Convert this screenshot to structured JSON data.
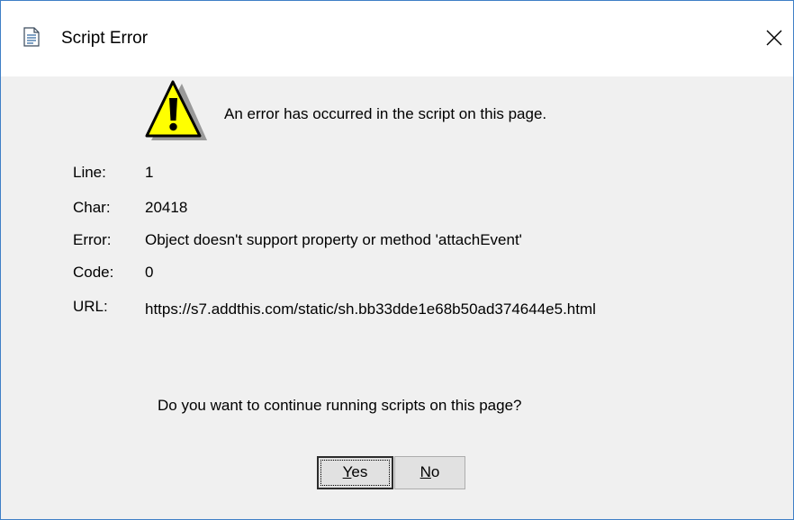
{
  "window": {
    "title": "Script Error",
    "title_icon": "document-icon",
    "close_icon": "close-icon"
  },
  "dialog": {
    "warning_icon": "warning-icon",
    "message": "An error has occurred in the script on this page.",
    "fields": {
      "line": {
        "label": "Line:",
        "value": "1"
      },
      "char": {
        "label": "Char:",
        "value": "20418"
      },
      "error": {
        "label": "Error:",
        "value": "Object doesn't support property or method 'attachEvent'"
      },
      "code": {
        "label": "Code:",
        "value": "0"
      },
      "url": {
        "label": "URL:",
        "value": "https://s7.addthis.com/static/sh.bb33dde1e68b50ad374644e5.html"
      }
    },
    "question": "Do you want to continue running scripts on this page?",
    "buttons": {
      "yes": {
        "mnemonic": "Y",
        "rest": "es"
      },
      "no": {
        "mnemonic": "N",
        "rest": "o"
      }
    }
  },
  "colors": {
    "window_border": "#3f7fc6",
    "dialog_bg": "#f0f0f0",
    "warning_fill": "#ffff00"
  }
}
